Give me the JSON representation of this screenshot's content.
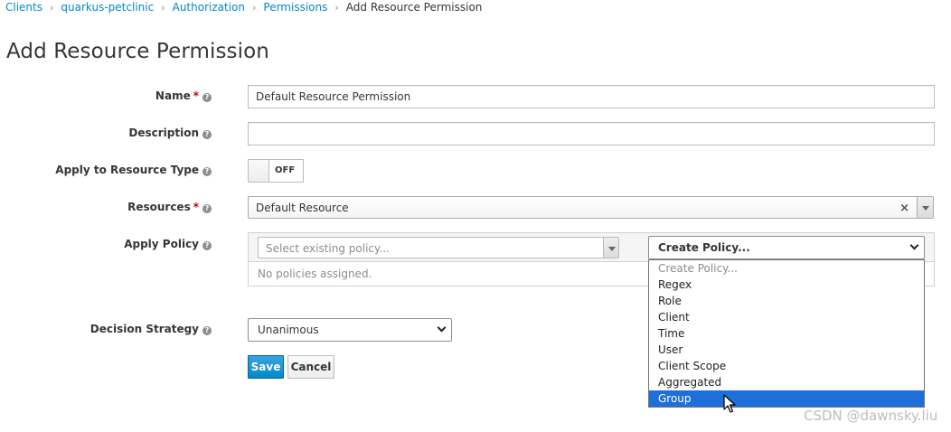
{
  "breadcrumb": {
    "items": [
      "Clients",
      "quarkus-petclinic",
      "Authorization",
      "Permissions"
    ],
    "current": "Add Resource Permission",
    "separator": "›"
  },
  "page_title": "Add Resource Permission",
  "form": {
    "name": {
      "label": "Name",
      "value": "Default Resource Permission"
    },
    "description": {
      "label": "Description",
      "value": ""
    },
    "apply_resource_type": {
      "label": "Apply to Resource Type",
      "toggle_text": "OFF"
    },
    "resources": {
      "label": "Resources",
      "value": "Default Resource",
      "clear": "×"
    },
    "apply_policy": {
      "label": "Apply Policy",
      "existing_placeholder": "Select existing policy...",
      "create_selected": "Create Policy...",
      "no_policies": "No policies assigned.",
      "options": [
        "Create Policy...",
        "Regex",
        "Role",
        "Client",
        "Time",
        "User",
        "Client Scope",
        "Aggregated",
        "Group"
      ],
      "highlighted_option": "Group"
    },
    "decision_strategy": {
      "label": "Decision Strategy",
      "value": "Unanimous"
    }
  },
  "buttons": {
    "save": "Save",
    "cancel": "Cancel"
  },
  "required_mark": "*",
  "help_glyph": "?",
  "watermark": "CSDN @dawnsky.liu",
  "colors": {
    "link": "#0088ce",
    "primary": "#0088ce",
    "required": "#cc0000",
    "highlight": "#1e6fd9"
  }
}
